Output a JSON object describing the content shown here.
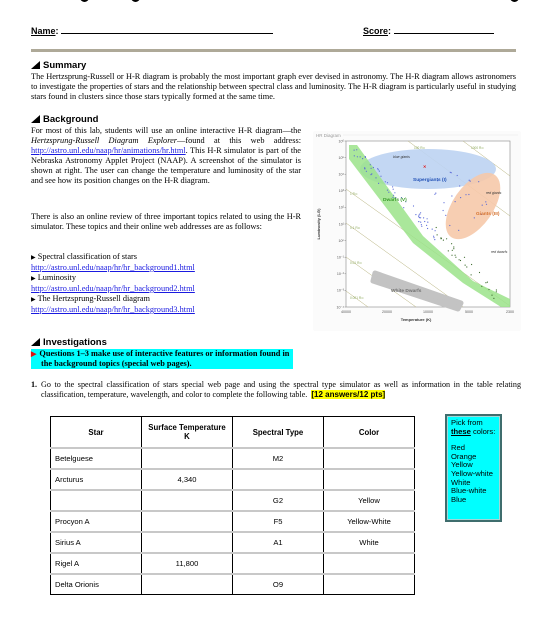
{
  "header": {
    "name_label": "Name",
    "score_label": "Score"
  },
  "summary": {
    "heading": "Summary",
    "text": "The Hertzsprung-Russell or H-R diagram is probably the most important graph ever devised in astronomy. The H-R diagram allows astronomers to investigate the properties of stars and the relationship between spectral class and luminosity. The H-R diagram is particularly useful in studying stars found in clusters since those stars typically formed at the same time."
  },
  "background": {
    "heading": "Background",
    "p1_before": "For most of this lab, students will use an online interactive H-R diagram—the ",
    "p1_italic": "Hertzsprung-Russell Diagram Explorer",
    "p1_mid": "—found at this web address: ",
    "p1_link": "http://astro.unl.edu/naap/hr/animations/hr.html",
    "p1_after": ". This H-R simulator is part of the Nebraska Astronomy Applet Project (NAAP). A screenshot of the simulator is shown at right. The user can change the temperature and luminosity of the star and see how its position changes on the H-R diagram.",
    "p2": "There is also an online review of three important topics related to using the H-R simulator. These topics and their online web addresses are as follows:",
    "topics": [
      {
        "label": "Spectral classification of stars",
        "url": "http://astro.unl.edu/naap/hr/hr_background1.html"
      },
      {
        "label": "Luminosity",
        "url": "http://astro.unl.edu/naap/hr/hr_background2.html"
      },
      {
        "label": "The Hertzsprung-Russell diagram",
        "url": "http://astro.unl.edu/naap/hr/hr_background3.html"
      }
    ]
  },
  "hr_diagram": {
    "title": "HR Diagram",
    "ylabel": "Luminosity (L⊙)",
    "xlabel": "Temperature (K)",
    "y_ticks": [
      "10⁶",
      "10⁵",
      "10⁴",
      "10³",
      "10²",
      "10¹",
      "10⁰",
      "10⁻¹",
      "10⁻²",
      "10⁻³",
      "10⁻⁴"
    ],
    "x_ticks": [
      "40000",
      "20000",
      "10000",
      "5000",
      "2300"
    ],
    "regions": [
      "Supergiants (I)",
      "Giants (III)",
      "Dwarfs (V)",
      "White Dwarfs"
    ],
    "annotations": [
      "blue giants",
      "red giants",
      "red dwarfs",
      "100 R⊙",
      "1000 R⊙",
      "1 R⊙",
      "0.1 R⊙",
      "0.01 R⊙",
      "0.001 R⊙"
    ]
  },
  "investigations": {
    "heading": "Investigations",
    "note": "Questions 1–3 make use of interactive features or information found in the background topics (special web pages).",
    "q1_number": "1.",
    "q1_text": "Go to the spectral classification of stars special web page and using the spectral type simulator as well as information in the table relating classification, temperature, wavelength, and color to complete the following table.",
    "q1_points": "[12 answers/12 pts]"
  },
  "table": {
    "headers": [
      "Star",
      "Surface Temperature K",
      "Spectral Type",
      "Color"
    ],
    "rows": [
      [
        "Betelguese",
        "",
        "M2",
        ""
      ],
      [
        "Arcturus",
        "4,340",
        "",
        ""
      ],
      [
        "",
        "",
        "G2",
        "Yellow"
      ],
      [
        "Procyon A",
        "",
        "F5",
        "Yellow-White"
      ],
      [
        "Sirius A",
        "",
        "A1",
        "White"
      ],
      [
        "Rigel A",
        "11,800",
        "",
        ""
      ],
      [
        "Delta Orionis",
        "",
        "O9",
        ""
      ]
    ]
  },
  "pick_box": {
    "line1": "Pick from",
    "emph": "these",
    "line2_rest": " colors:",
    "colors": [
      "Red",
      "Orange",
      "Yellow",
      "Yellow-white",
      "White",
      "Blue-white",
      "Blue"
    ]
  }
}
